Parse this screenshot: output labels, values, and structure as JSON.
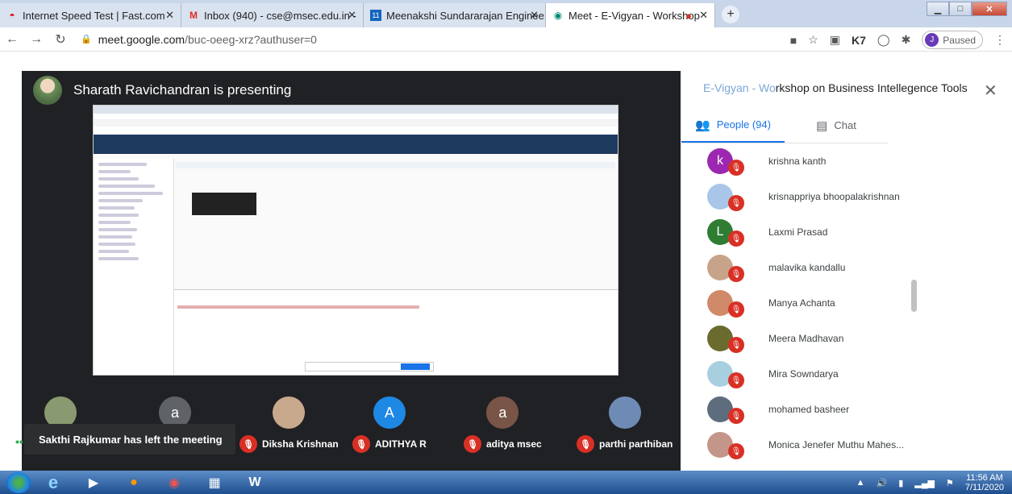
{
  "browser": {
    "tabs": [
      {
        "title": "Internet Speed Test | Fast.com",
        "icon": "fast-icon"
      },
      {
        "title": "Inbox (940) - cse@msec.edu.in -",
        "icon": "gmail-icon"
      },
      {
        "title": "Meenakshi Sundararajan Enginee",
        "icon": "college-icon"
      },
      {
        "title": "Meet - E-Vigyan - Workshop",
        "icon": "meet-icon"
      }
    ],
    "url_host": "meet.google.com",
    "url_path": "/buc-oeeg-xrz?authuser=0",
    "profile_initial": "J",
    "profile_status": "Paused",
    "ext_label": "K7"
  },
  "meeting": {
    "presenter": "Sharath Ravichandran is presenting",
    "title_faded": "E-Vigyan - Wo",
    "title": "rkshop on Business Intellegence Tools",
    "toast": "Sakthi Rajkumar has left the meeting",
    "tiles": [
      {
        "initial": "",
        "name": "",
        "color": "#8a9a70"
      },
      {
        "initial": "a",
        "name": "",
        "color": "#5f6368"
      },
      {
        "initial": "",
        "name": "Diksha Krishnan",
        "color": "#c9a98d"
      },
      {
        "initial": "A",
        "name": "ADITHYA R",
        "color": "#1e88e5"
      },
      {
        "initial": "a",
        "name": "aditya msec",
        "color": "#795548"
      },
      {
        "initial": "",
        "name": "parthi parthiban",
        "color": "#6d8bb5"
      }
    ]
  },
  "panel": {
    "people_tab": "People (94)",
    "chat_tab": "Chat",
    "people": [
      {
        "initial": "k",
        "name": "krishna kanth",
        "color": "#9c27b0"
      },
      {
        "initial": "",
        "name": "krisnappriya bhoopalakrishnan",
        "color": "#a9c6e8"
      },
      {
        "initial": "L",
        "name": "Laxmi Prasad",
        "color": "#2e7d32"
      },
      {
        "initial": "",
        "name": "malavika kandallu",
        "color": "#c7a489"
      },
      {
        "initial": "",
        "name": "Manya Achanta",
        "color": "#d08a6a"
      },
      {
        "initial": "",
        "name": "Meera Madhavan",
        "color": "#6b6b2f"
      },
      {
        "initial": "",
        "name": "Mira Sowndarya",
        "color": "#a8cfe0"
      },
      {
        "initial": "",
        "name": "mohamed basheer",
        "color": "#5d6d7e"
      },
      {
        "initial": "",
        "name": "Monica Jenefer Muthu Mahes...",
        "color": "#c4968a"
      }
    ]
  },
  "taskbar": {
    "time": "11:56 AM",
    "date": "7/11/2020"
  }
}
